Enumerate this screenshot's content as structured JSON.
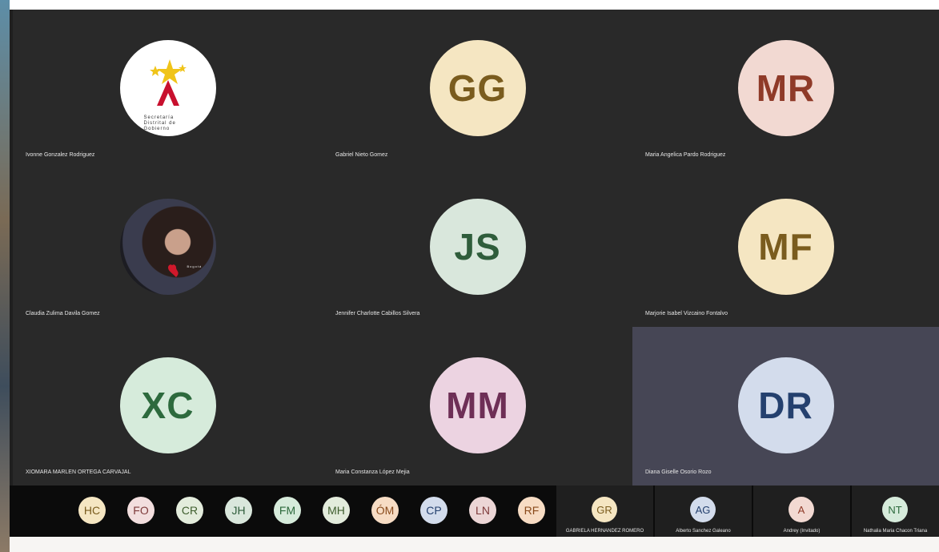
{
  "tiles": [
    {
      "name": "Ivonne Gonzalez Rodriguez",
      "avatar": "logo",
      "logo_text": "Secretaría Distrital de Gobierno",
      "colors": {
        "bg": "#ffffff"
      }
    },
    {
      "name": "Gabriel Nieto Gomez",
      "initials": "GG",
      "colors": {
        "bg": "#f5e6c2",
        "fg": "#7a5c1e"
      }
    },
    {
      "name": "Maria Angelica Pardo Rodriguez",
      "initials": "MR",
      "colors": {
        "bg": "#f2d9d2",
        "fg": "#8f3a28"
      }
    },
    {
      "name": "Claudia Zulima Davila Gomez",
      "avatar": "photo",
      "photo_caption": "Bogotá",
      "colors": {
        "bg": "#3b2f2c"
      }
    },
    {
      "name": "Jennifer Charlotte Cabillos Silvera",
      "initials": "JS",
      "colors": {
        "bg": "#d9e7dc",
        "fg": "#2f5d3b"
      }
    },
    {
      "name": "Marjorie Isabel Vizcaino Fontalvo",
      "initials": "MF",
      "colors": {
        "bg": "#f5e6c2",
        "fg": "#7a5c1e"
      }
    },
    {
      "name": "XIOMARA MARLEN ORTEGA CARVAJAL",
      "initials": "XC",
      "colors": {
        "bg": "#d6ebdb",
        "fg": "#2d6a3d"
      }
    },
    {
      "name": "Maria Constanza López Mejia",
      "initials": "MM",
      "colors": {
        "bg": "#ecd3e1",
        "fg": "#6e2f56"
      }
    },
    {
      "name": "Diana Giselle Osorio Rozo",
      "initials": "DR",
      "colors": {
        "bg": "#d3dcec",
        "fg": "#24406e"
      },
      "active": true
    }
  ],
  "overflow_chips": [
    {
      "initials": "HC",
      "bg": "#f5e6c2",
      "fg": "#7a5c1e"
    },
    {
      "initials": "FO",
      "bg": "#f2dede",
      "fg": "#7e3b3b"
    },
    {
      "initials": "CR",
      "bg": "#e3ecdc",
      "fg": "#3f5e2e"
    },
    {
      "initials": "JH",
      "bg": "#d9e7dc",
      "fg": "#2f5d3b"
    },
    {
      "initials": "FM",
      "bg": "#d6ebdb",
      "fg": "#2d6a3d"
    },
    {
      "initials": "MH",
      "bg": "#e3ecdc",
      "fg": "#3f5e2e"
    },
    {
      "initials": "ÓM",
      "bg": "#f7dcc4",
      "fg": "#8a4b1c"
    },
    {
      "initials": "CP",
      "bg": "#d3dcec",
      "fg": "#24406e"
    },
    {
      "initials": "LN",
      "bg": "#ecd6d6",
      "fg": "#7e3b3b"
    },
    {
      "initials": "RF",
      "bg": "#f7dcc4",
      "fg": "#8a4b1c"
    }
  ],
  "participants": [
    {
      "initials": "GR",
      "name": "GABRIELA HERNANDEZ ROMERO",
      "bg": "#f5e6c2",
      "fg": "#7a5c1e"
    },
    {
      "initials": "AG",
      "name": "Alberto Sanchez Galeano",
      "bg": "#d3dcec",
      "fg": "#24406e"
    },
    {
      "initials": "A",
      "name": "Andrey (Invitado)",
      "bg": "#f2d9d2",
      "fg": "#8f3a28"
    },
    {
      "initials": "NT",
      "name": "Nathalia Maria Chacon Triana",
      "bg": "#d6ebdb",
      "fg": "#2d6a3d"
    }
  ]
}
